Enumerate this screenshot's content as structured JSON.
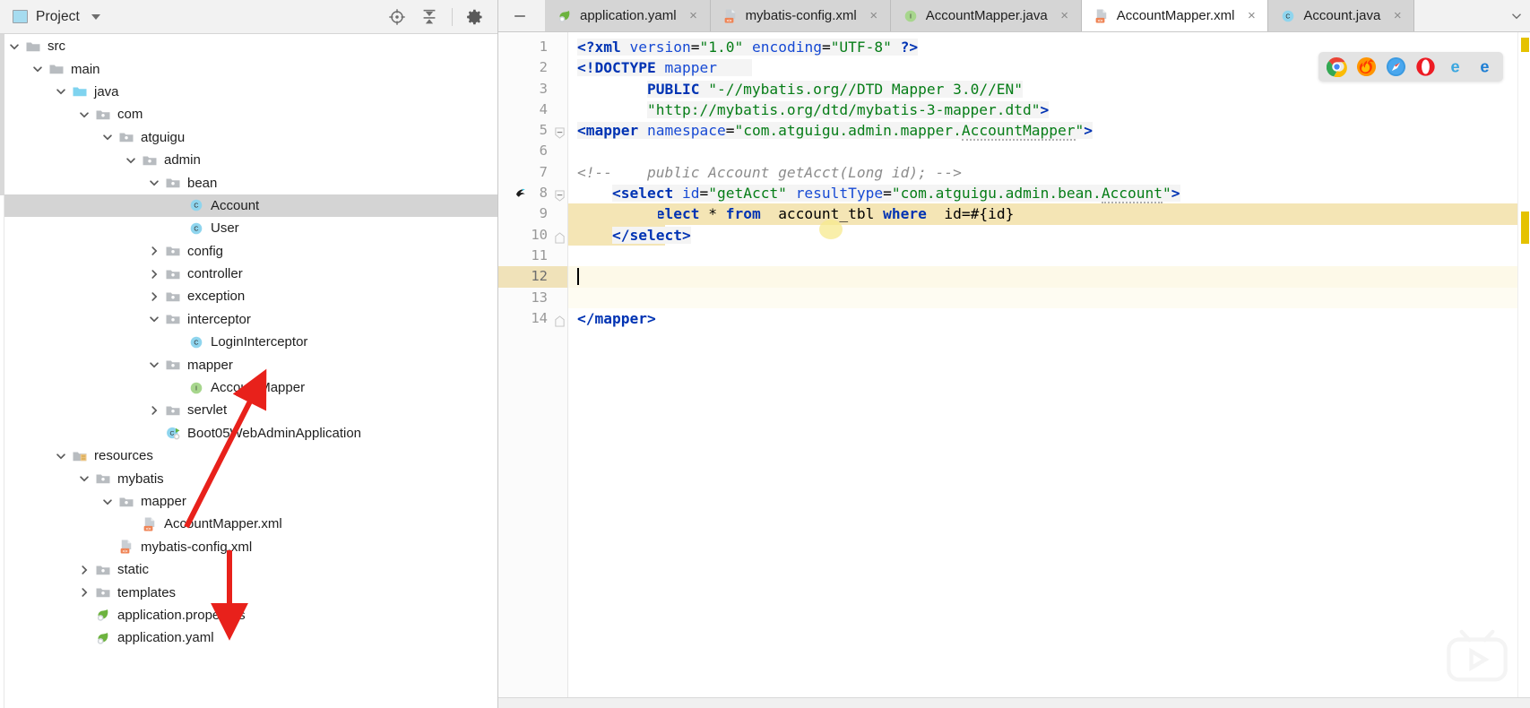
{
  "window": {
    "app": "IntelliJ IDEA",
    "theme_accent": "#e5c200"
  },
  "project_panel": {
    "title": "Project",
    "title_icon": "project-panel-icon",
    "caret_icon": "chevron-down-icon",
    "actions": [
      {
        "name": "select-opened-file-icon",
        "label": "Select Opened File"
      },
      {
        "name": "collapse-all-icon",
        "label": "Collapse All"
      },
      {
        "name": "settings-gear-icon",
        "label": "Settings"
      }
    ],
    "tree": [
      {
        "label": "src",
        "depth": 1,
        "twisty": "expanded",
        "icon": "folder-gray",
        "selected": false
      },
      {
        "label": "main",
        "depth": 2,
        "twisty": "expanded",
        "icon": "folder-gray",
        "selected": false
      },
      {
        "label": "java",
        "depth": 3,
        "twisty": "expanded",
        "icon": "folder-source",
        "selected": false
      },
      {
        "label": "com",
        "depth": 4,
        "twisty": "expanded",
        "icon": "folder-pkg",
        "selected": false
      },
      {
        "label": "atguigu",
        "depth": 5,
        "twisty": "expanded",
        "icon": "folder-pkg",
        "selected": false
      },
      {
        "label": "admin",
        "depth": 6,
        "twisty": "expanded",
        "icon": "folder-pkg",
        "selected": false
      },
      {
        "label": "bean",
        "depth": 7,
        "twisty": "expanded",
        "icon": "folder-pkg",
        "selected": false
      },
      {
        "label": "Account",
        "depth": 8,
        "twisty": "none",
        "icon": "java-class",
        "selected": true
      },
      {
        "label": "User",
        "depth": 8,
        "twisty": "none",
        "icon": "java-class",
        "selected": false
      },
      {
        "label": "config",
        "depth": 7,
        "twisty": "collapsed",
        "icon": "folder-pkg",
        "selected": false
      },
      {
        "label": "controller",
        "depth": 7,
        "twisty": "collapsed",
        "icon": "folder-pkg",
        "selected": false
      },
      {
        "label": "exception",
        "depth": 7,
        "twisty": "collapsed",
        "icon": "folder-pkg",
        "selected": false
      },
      {
        "label": "interceptor",
        "depth": 7,
        "twisty": "expanded",
        "icon": "folder-pkg",
        "selected": false
      },
      {
        "label": "LoginInterceptor",
        "depth": 8,
        "twisty": "none",
        "icon": "java-class",
        "selected": false
      },
      {
        "label": "mapper",
        "depth": 7,
        "twisty": "expanded",
        "icon": "folder-pkg",
        "selected": false
      },
      {
        "label": "AccountMapper",
        "depth": 8,
        "twisty": "none",
        "icon": "java-interface",
        "selected": false
      },
      {
        "label": "servlet",
        "depth": 7,
        "twisty": "collapsed",
        "icon": "folder-pkg",
        "selected": false
      },
      {
        "label": "Boot05WebAdminApplication",
        "depth": 7,
        "twisty": "none",
        "icon": "spring-boot-class",
        "selected": false
      },
      {
        "label": "resources",
        "depth": 3,
        "twisty": "expanded",
        "icon": "folder-resources",
        "selected": false
      },
      {
        "label": "mybatis",
        "depth": 4,
        "twisty": "expanded",
        "icon": "folder-pkg",
        "selected": false
      },
      {
        "label": "mapper",
        "depth": 5,
        "twisty": "expanded",
        "icon": "folder-pkg",
        "selected": false
      },
      {
        "label": "AccountMapper.xml",
        "depth": 6,
        "twisty": "none",
        "icon": "xml-file",
        "selected": false
      },
      {
        "label": "mybatis-config.xml",
        "depth": 5,
        "twisty": "none",
        "icon": "xml-file",
        "selected": false
      },
      {
        "label": "static",
        "depth": 4,
        "twisty": "collapsed",
        "icon": "folder-pkg",
        "selected": false
      },
      {
        "label": "templates",
        "depth": 4,
        "twisty": "collapsed",
        "icon": "folder-pkg",
        "selected": false
      },
      {
        "label": "application.properties",
        "depth": 4,
        "twisty": "none",
        "icon": "spring-file",
        "selected": false
      },
      {
        "label": "application.yaml",
        "depth": 4,
        "twisty": "none",
        "icon": "spring-file",
        "selected": false
      }
    ]
  },
  "editor": {
    "minimize_icon": "minimize-window-icon",
    "tabs": [
      {
        "label": "application.yaml",
        "icon": "spring-file",
        "active": false,
        "close": "×"
      },
      {
        "label": "mybatis-config.xml",
        "icon": "xml-file",
        "active": false,
        "close": "×"
      },
      {
        "label": "AccountMapper.java",
        "icon": "java-interface",
        "active": false,
        "close": "×"
      },
      {
        "label": "AccountMapper.xml",
        "icon": "xml-file",
        "active": true,
        "close": "×"
      },
      {
        "label": "Account.java",
        "icon": "java-class",
        "active": false,
        "close": "×"
      }
    ],
    "browser_launchers": [
      {
        "name": "chrome-icon",
        "label": "Chrome"
      },
      {
        "name": "firefox-icon",
        "label": "Firefox"
      },
      {
        "name": "safari-icon",
        "label": "Safari"
      },
      {
        "name": "opera-icon",
        "label": "Opera"
      },
      {
        "name": "internet-explorer-icon",
        "label": "Internet Explorer"
      },
      {
        "name": "edge-icon",
        "label": "Edge"
      }
    ],
    "line_numbers": [
      "1",
      "2",
      "3",
      "4",
      "5",
      "6",
      "7",
      "8",
      "9",
      "10",
      "11",
      "12",
      "13",
      "14"
    ],
    "caret_line": 12,
    "gutter_markers": [
      {
        "line": 8,
        "name": "mybatis-navigate-icon"
      }
    ],
    "code_lines": [
      {
        "n": 1,
        "text": "<?xml version=\"1.0\" encoding=\"UTF-8\" ?>"
      },
      {
        "n": 2,
        "text": "<!DOCTYPE mapper"
      },
      {
        "n": 3,
        "text": "        PUBLIC \"-//mybatis.org//DTD Mapper 3.0//EN\""
      },
      {
        "n": 4,
        "text": "        \"http://mybatis.org/dtd/mybatis-3-mapper.dtd\">"
      },
      {
        "n": 5,
        "text": "<mapper namespace=\"com.atguigu.admin.mapper.AccountMapper\">"
      },
      {
        "n": 6,
        "text": ""
      },
      {
        "n": 7,
        "text": "<!--    public Account getAcct(Long id); -->"
      },
      {
        "n": 8,
        "text": "    <select id=\"getAcct\" resultType=\"com.atguigu.admin.bean.Account\">"
      },
      {
        "n": 9,
        "text": "        select * from  account_tbl where  id=#{id}"
      },
      {
        "n": 10,
        "text": "    </select>"
      },
      {
        "n": 11,
        "text": ""
      },
      {
        "n": 12,
        "text": ""
      },
      {
        "n": 13,
        "text": ""
      },
      {
        "n": 14,
        "text": "</mapper>"
      }
    ]
  },
  "annotations": {
    "arrows": [
      {
        "name": "arrow-to-account-mapper-interface",
        "color": "#e8211b"
      },
      {
        "name": "arrow-to-application-yaml",
        "color": "#e8211b"
      }
    ]
  }
}
